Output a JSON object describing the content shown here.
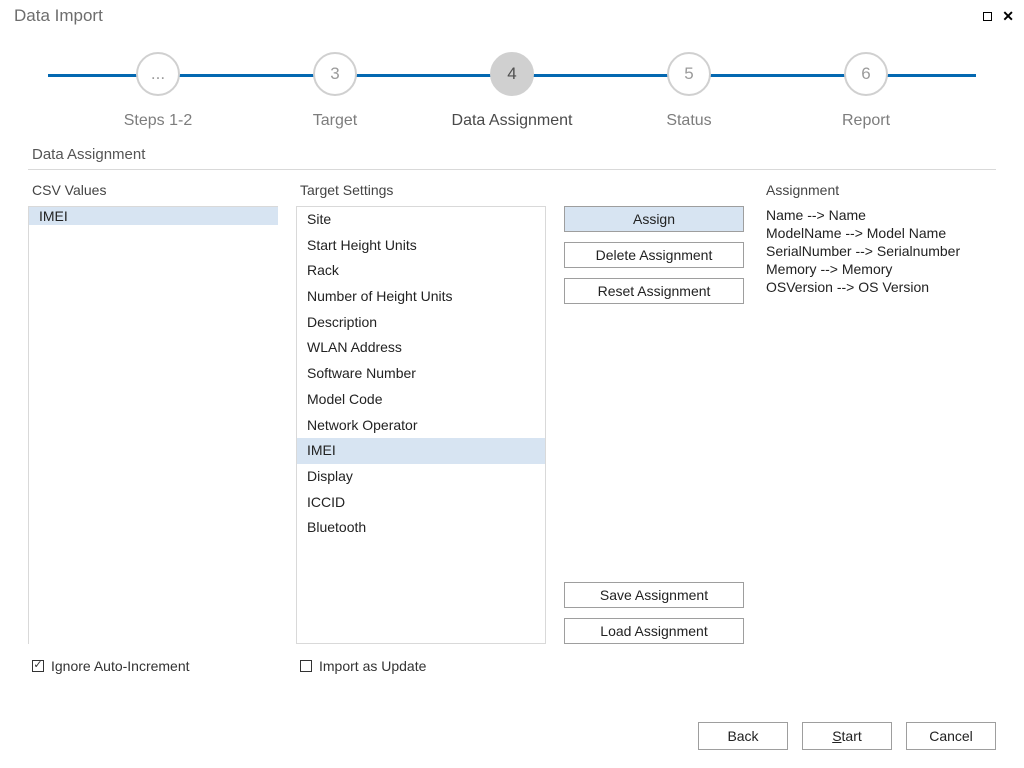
{
  "window": {
    "title": "Data Import"
  },
  "stepper": {
    "steps": [
      {
        "num": "...",
        "label": "Steps 1-2"
      },
      {
        "num": "3",
        "label": "Target"
      },
      {
        "num": "4",
        "label": "Data Assignment"
      },
      {
        "num": "5",
        "label": "Status"
      },
      {
        "num": "6",
        "label": "Report"
      }
    ],
    "activeIndex": 2
  },
  "section_title": "Data Assignment",
  "panels": {
    "csv_title": "CSV Values",
    "target_title": "Target Settings",
    "assign_title": "Assignment"
  },
  "csv_values": {
    "items": [
      "IMEI"
    ],
    "selectedIndex": 0
  },
  "target_settings": {
    "items": [
      "Site",
      "Start Height Units",
      "Rack",
      "Number of Height Units",
      "Description",
      "WLAN Address",
      "Software Number",
      "Model Code",
      "Network Operator",
      "IMEI",
      "Display",
      "ICCID",
      "Bluetooth"
    ],
    "selectedIndex": 9
  },
  "assignments": [
    "Name --> Name",
    "ModelName --> Model Name",
    "SerialNumber --> Serialnumber",
    "Memory --> Memory",
    "OSVersion --> OS Version"
  ],
  "buttons": {
    "assign": "Assign",
    "delete": "Delete Assignment",
    "reset": "Reset Assignment",
    "save": "Save Assignment",
    "load": "Load Assignment"
  },
  "options": {
    "ignore_auto_increment": {
      "label": "Ignore Auto-Increment",
      "checked": true
    },
    "import_as_update": {
      "label": "Import as Update",
      "checked": false
    }
  },
  "footer": {
    "back": "Back",
    "start_prefix": "S",
    "start_rest": "tart",
    "cancel": "Cancel"
  }
}
